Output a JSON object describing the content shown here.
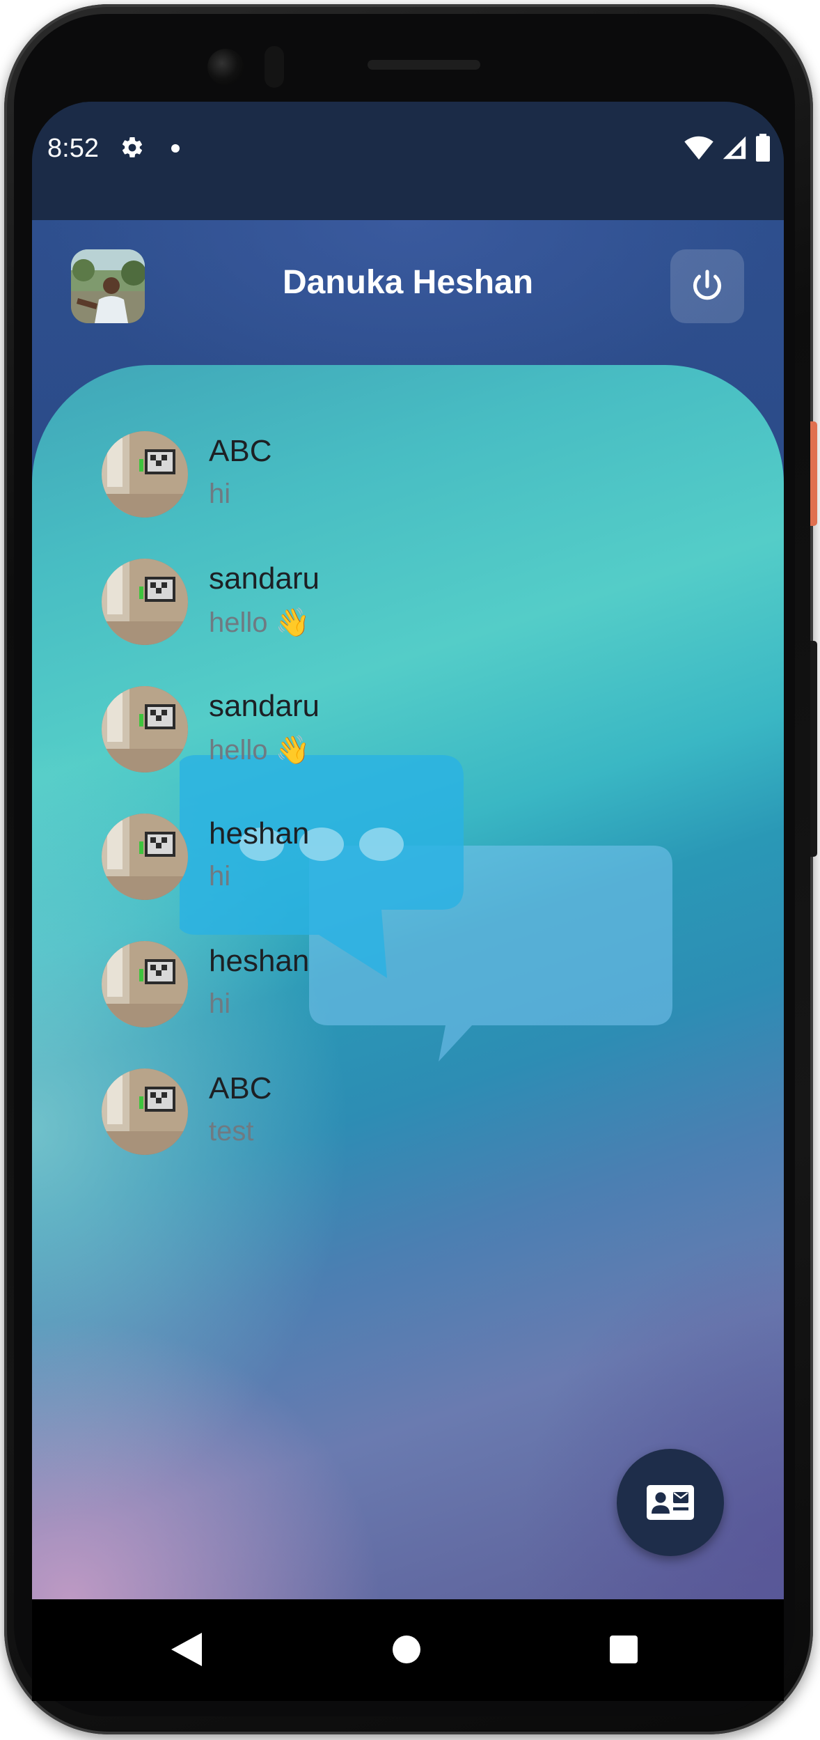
{
  "status_bar": {
    "time": "8:52",
    "left_icons": [
      "gear-icon",
      "notification-dot-icon"
    ],
    "right_icons": [
      "wifi-icon",
      "signal-icon",
      "battery-icon"
    ]
  },
  "app_bar": {
    "title": "Danuka Heshan",
    "avatar_icon": "profile-photo",
    "logout_icon": "power-icon"
  },
  "chats": [
    {
      "name": "ABC",
      "last_message": "hi"
    },
    {
      "name": "sandaru",
      "last_message": "hello 👋"
    },
    {
      "name": "sandaru",
      "last_message": "hello 👋"
    },
    {
      "name": "heshan",
      "last_message": "hi"
    },
    {
      "name": "heshan",
      "last_message": "hi"
    },
    {
      "name": "ABC",
      "last_message": "test"
    }
  ],
  "fab": {
    "icon": "contact-mail-icon"
  },
  "nav_bar": {
    "icons": [
      "back-icon",
      "home-icon",
      "recents-icon"
    ]
  },
  "colors": {
    "header_bg": "#1b2b47",
    "app_bar_bg": "#2e4f8e",
    "fab_bg": "#1e2d4a",
    "name_text": "#1d2024",
    "message_text": "#6f7a82"
  }
}
